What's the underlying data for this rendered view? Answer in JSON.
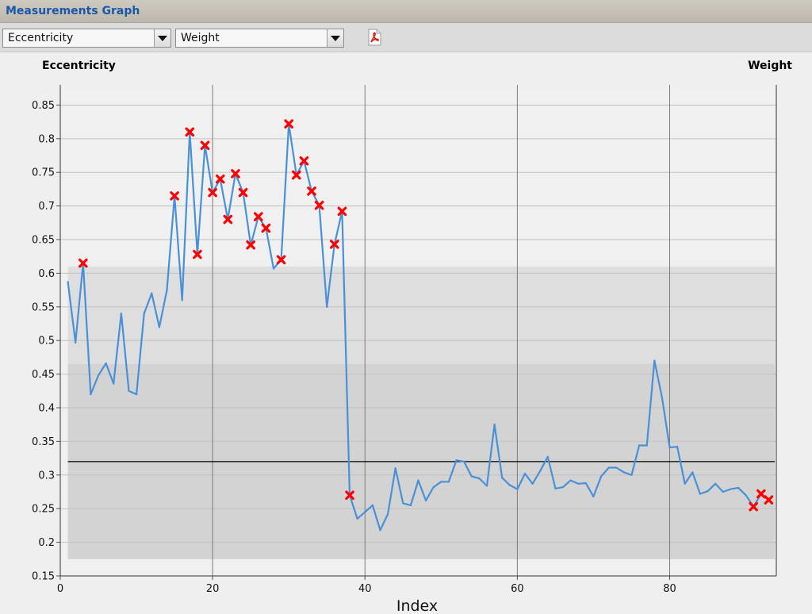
{
  "window": {
    "title": "Measurements Graph"
  },
  "toolbar": {
    "left_select": "Eccentricity",
    "right_select": "Weight",
    "export_icon": "pdf-icon"
  },
  "chart_data": {
    "type": "line",
    "left_axis_title": "Eccentricity",
    "right_axis_title": "Weight",
    "xlabel": "Index",
    "xlim": [
      0,
      94
    ],
    "ylim": [
      0.15,
      0.88
    ],
    "x_ticks": [
      0,
      20,
      40,
      60,
      80
    ],
    "y_ticks": [
      0.15,
      0.2,
      0.25,
      0.3,
      0.35,
      0.4,
      0.45,
      0.5,
      0.55,
      0.6,
      0.65,
      0.7,
      0.75,
      0.8,
      0.85
    ],
    "reference_line": 0.32,
    "bands": [
      {
        "y0": 0.175,
        "y1": 0.61,
        "color": "#dedede"
      },
      {
        "y0": 0.175,
        "y1": 0.465,
        "color": "#d3d3d3"
      }
    ],
    "series": [
      {
        "color": "#4a90d9",
        "x": [
          1,
          2,
          3,
          4,
          5,
          6,
          7,
          8,
          9,
          10,
          11,
          12,
          13,
          14,
          15,
          16,
          17,
          18,
          19,
          20,
          21,
          22,
          23,
          24,
          25,
          26,
          27,
          28,
          29,
          30,
          31,
          32,
          33,
          34,
          35,
          36,
          37,
          38,
          39,
          40,
          41,
          42,
          43,
          44,
          45,
          46,
          47,
          48,
          49,
          50,
          51,
          52,
          53,
          54,
          55,
          56,
          57,
          58,
          59,
          60,
          61,
          62,
          63,
          64,
          65,
          66,
          67,
          68,
          69,
          70,
          71,
          72,
          73,
          74,
          75,
          76,
          77,
          78,
          79,
          80,
          81,
          82,
          83,
          84,
          85,
          86,
          87,
          88,
          89,
          90,
          91,
          92,
          93
        ],
        "y": [
          0.587,
          0.497,
          0.615,
          0.42,
          0.448,
          0.466,
          0.436,
          0.54,
          0.425,
          0.42,
          0.54,
          0.57,
          0.52,
          0.575,
          0.715,
          0.56,
          0.81,
          0.628,
          0.79,
          0.72,
          0.74,
          0.68,
          0.748,
          0.72,
          0.642,
          0.684,
          0.667,
          0.607,
          0.62,
          0.822,
          0.746,
          0.767,
          0.722,
          0.701,
          0.55,
          0.643,
          0.692,
          0.27,
          0.235,
          0.245,
          0.255,
          0.218,
          0.242,
          0.31,
          0.258,
          0.255,
          0.292,
          0.262,
          0.282,
          0.29,
          0.29,
          0.322,
          0.32,
          0.298,
          0.295,
          0.284,
          0.375,
          0.296,
          0.285,
          0.279,
          0.302,
          0.287,
          0.306,
          0.327,
          0.28,
          0.282,
          0.292,
          0.287,
          0.288,
          0.268,
          0.298,
          0.311,
          0.311,
          0.304,
          0.3,
          0.344,
          0.344,
          0.47,
          0.415,
          0.341,
          0.342,
          0.287,
          0.304,
          0.272,
          0.276,
          0.287,
          0.275,
          0.279,
          0.281,
          0.27,
          0.253,
          0.272,
          0.263
        ]
      }
    ],
    "flagged_points": [
      {
        "x": 3,
        "y": 0.615
      },
      {
        "x": 15,
        "y": 0.715
      },
      {
        "x": 17,
        "y": 0.81
      },
      {
        "x": 18,
        "y": 0.628
      },
      {
        "x": 19,
        "y": 0.79
      },
      {
        "x": 20,
        "y": 0.72
      },
      {
        "x": 21,
        "y": 0.74
      },
      {
        "x": 22,
        "y": 0.68
      },
      {
        "x": 23,
        "y": 0.748
      },
      {
        "x": 24,
        "y": 0.72
      },
      {
        "x": 25,
        "y": 0.642
      },
      {
        "x": 26,
        "y": 0.684
      },
      {
        "x": 27,
        "y": 0.667
      },
      {
        "x": 29,
        "y": 0.62
      },
      {
        "x": 30,
        "y": 0.822
      },
      {
        "x": 31,
        "y": 0.746
      },
      {
        "x": 32,
        "y": 0.767
      },
      {
        "x": 33,
        "y": 0.722
      },
      {
        "x": 34,
        "y": 0.701
      },
      {
        "x": 36,
        "y": 0.643
      },
      {
        "x": 37,
        "y": 0.692
      },
      {
        "x": 38,
        "y": 0.27
      },
      {
        "x": 91,
        "y": 0.253
      },
      {
        "x": 92,
        "y": 0.272
      },
      {
        "x": 93,
        "y": 0.263
      }
    ],
    "grid": true
  }
}
